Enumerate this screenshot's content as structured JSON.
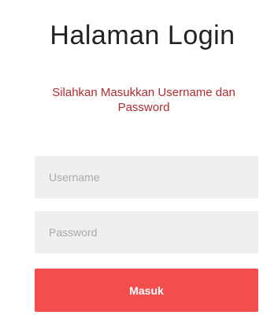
{
  "login": {
    "title": "Halaman Login",
    "subtitle_line1": "Silahkan Masukkan Username dan",
    "subtitle_line2": "Password",
    "username": {
      "placeholder": "Username",
      "value": ""
    },
    "password": {
      "placeholder": "Password",
      "value": ""
    },
    "submit_label": "Masuk"
  },
  "colors": {
    "background": "#ffffff",
    "title": "#222222",
    "subtitle": "#b02a30",
    "field_background": "#efefef",
    "placeholder": "#a8a8a8",
    "button": "#f24e4e",
    "button_text": "#ffffff"
  }
}
